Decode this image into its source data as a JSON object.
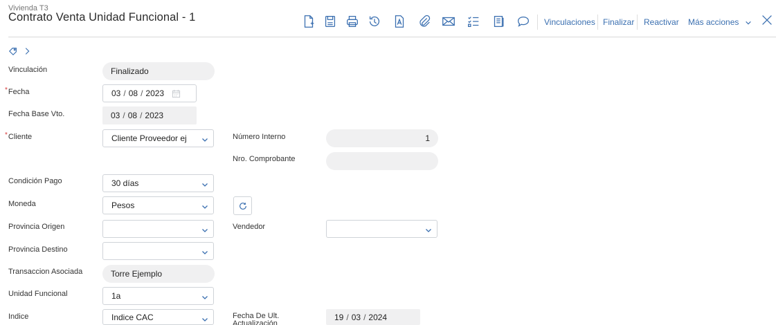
{
  "header": {
    "subtitle": "Vivienda T3",
    "title": "Contrato Venta Unidad Funcional - 1"
  },
  "toolbar": {
    "vinculaciones": "Vinculaciones",
    "finalizar": "Finalizar",
    "reactivar": "Reactivar",
    "mas_acciones": "Más acciones",
    "accent": "#3a6fb0"
  },
  "form": {
    "vinculacion": {
      "label": "Vinculación",
      "value": "Finalizado"
    },
    "fecha": {
      "label": "Fecha",
      "day": "03",
      "month": "08",
      "year": "2023"
    },
    "fecha_base_vto": {
      "label": "Fecha Base Vto.",
      "day": "03",
      "month": "08",
      "year": "2023"
    },
    "cliente": {
      "label": "Cliente",
      "value": "Cliente Proveedor ej"
    },
    "numero_interno": {
      "label": "Número Interno",
      "value": "1"
    },
    "nro_comprobante": {
      "label": "Nro. Comprobante",
      "value": ""
    },
    "condicion_pago": {
      "label": "Condición Pago",
      "value": "30 días"
    },
    "moneda": {
      "label": "Moneda",
      "value": "Pesos"
    },
    "provincia_origen": {
      "label": "Provincia Origen",
      "value": ""
    },
    "vendedor": {
      "label": "Vendedor",
      "value": ""
    },
    "provincia_destino": {
      "label": "Provincia Destino",
      "value": ""
    },
    "transaccion_asociada": {
      "label": "Transaccion Asociada",
      "value": "Torre Ejemplo"
    },
    "unidad_funcional": {
      "label": "Unidad Funcional",
      "value": "1a"
    },
    "indice": {
      "label": "Indice",
      "value": "Indice CAC"
    },
    "fecha_ult_act": {
      "label": "Fecha De Ult. Actualización",
      "day": "19",
      "month": "03",
      "year": "2024"
    }
  },
  "colors": {
    "required": "#d63b3b",
    "icon": "#3a6fb0",
    "field_bg": "#f0f0f1"
  }
}
